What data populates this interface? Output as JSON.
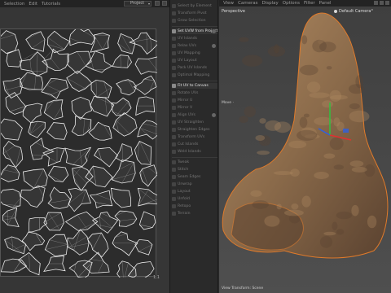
{
  "uv_editor": {
    "menu": [
      "Selection",
      "Edit",
      "Tutorials"
    ],
    "projection_value": "Project",
    "corner_value": "1,1"
  },
  "side_panel": {
    "items": [
      {
        "label": "Select by Element",
        "active": false
      },
      {
        "label": "Transform Pivot",
        "active": false
      },
      {
        "label": "Grow Selection",
        "active": false
      },
      {
        "label": "Set UVW from Projection",
        "active": true
      },
      {
        "label": "UV Islands",
        "active": false
      },
      {
        "label": "Relax UVs",
        "active": false
      },
      {
        "label": "UV Mapping",
        "active": false
      },
      {
        "label": "UV Layout",
        "active": false
      },
      {
        "label": "Pack UV Islands",
        "active": false
      },
      {
        "label": "Optimal Mapping",
        "active": false
      },
      {
        "label": "Fit UV to Canvas",
        "active": true
      },
      {
        "label": "Rotate UVs",
        "active": false
      },
      {
        "label": "Mirror U",
        "active": false
      },
      {
        "label": "Mirror V",
        "active": false
      },
      {
        "label": "Align UVs",
        "active": false
      },
      {
        "label": "UV Straighten",
        "active": false
      },
      {
        "label": "Straighten Edges",
        "active": false
      },
      {
        "label": "Transform UVs",
        "active": false
      },
      {
        "label": "Cut Islands",
        "active": false
      },
      {
        "label": "Weld Islands",
        "active": false
      },
      {
        "label": "Tweak",
        "active": false
      },
      {
        "label": "Stitch",
        "active": false
      },
      {
        "label": "Seam Edges",
        "active": false
      },
      {
        "label": "Unwrap",
        "active": false
      },
      {
        "label": "Layout",
        "active": false
      },
      {
        "label": "Unfold",
        "active": false
      },
      {
        "label": "Retopo",
        "active": false
      },
      {
        "label": "Terrain",
        "active": false
      }
    ]
  },
  "viewport": {
    "menu": [
      "View",
      "Cameras",
      "Display",
      "Options",
      "Filter",
      "Panel"
    ],
    "view_label": "Perspective",
    "camera_label": "Default Camera",
    "camera_suffix": "°",
    "axis_label": "Move",
    "axis_suffix": "·",
    "status": "View Transform: Scene"
  },
  "colors": {
    "rock_base": "#8a6a4a",
    "rock_light": "#b08a62",
    "rock_dark": "#5a4230",
    "selection_outline": "#e07a2a",
    "uv_lines": "#e8e8e8",
    "gizmo_x": "#e03030",
    "gizmo_y": "#30c040",
    "gizmo_z": "#3060e0"
  }
}
